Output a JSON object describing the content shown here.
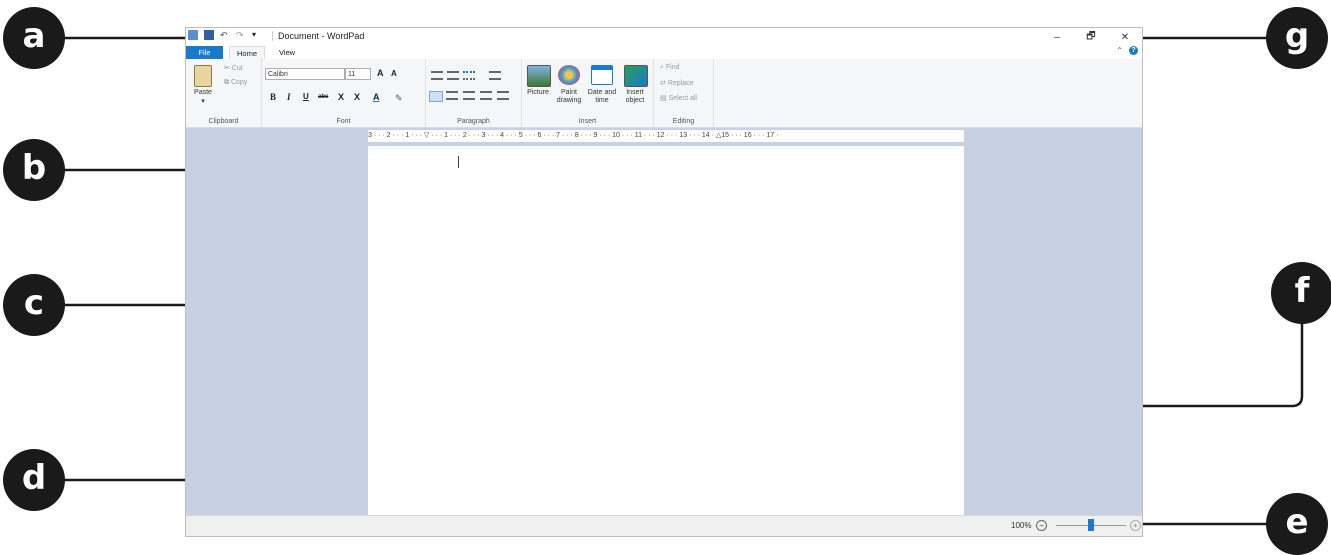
{
  "window": {
    "title": "Document - WordPad",
    "controls": {
      "minimize": "–",
      "restore": "🗗",
      "close": "✕"
    }
  },
  "tabs": {
    "file": "File",
    "home": "Home",
    "view": "View"
  },
  "ribbon": {
    "clipboard": {
      "paste": "Paste",
      "cut": "Cut",
      "copy": "Copy",
      "label": "Clipboard"
    },
    "font": {
      "family": "Calibri",
      "size": "11",
      "grow": "A",
      "shrink": "A",
      "bold": "B",
      "italic": "I",
      "underline": "U",
      "strike": "abc",
      "sub": "X",
      "sup": "X",
      "color": "A",
      "label": "Font"
    },
    "paragraph": {
      "label": "Paragraph"
    },
    "insert": {
      "picture": "Picture",
      "paint": "Paint drawing",
      "datetime": "Date and time",
      "object": "Insert object",
      "label": "Insert"
    },
    "editing": {
      "find": "Find",
      "replace": "Replace",
      "selectall": "Select all",
      "label": "Editing"
    }
  },
  "ruler": {
    "marks": "3 · · · 2 · · · 1 · · · ▽ · · · 1 · · · 2 · · · 3 · · · 4 · · · 5 · · · 6 · · · 7 · · · 8 · · · 9 · · · 10 · · · 11 · · · 12 · · · 13 · · · 14 · △15 · · · 16 · · · 17 ·"
  },
  "status": {
    "zoom": "100%",
    "minus": "−",
    "plus": "+",
    "zoom_level": 100
  },
  "callouts": {
    "a": "a",
    "b": "b",
    "c": "c",
    "d": "d",
    "e": "e",
    "f": "f",
    "g": "g"
  },
  "colors": {
    "accent": "#1979ca",
    "page_bg": "#c7d1e3",
    "callout": "#1a1a1a"
  }
}
